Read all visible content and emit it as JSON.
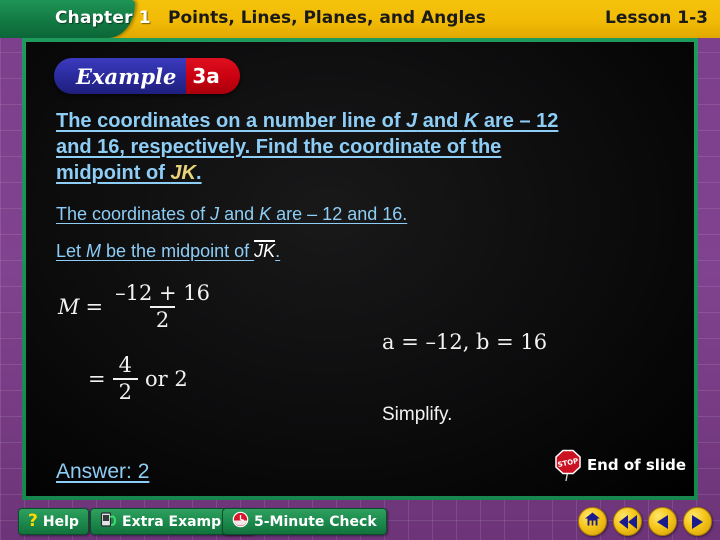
{
  "header": {
    "chapter_label": "Chapter 1",
    "title": "Points, Lines, Planes, and Angles",
    "lesson_label": "Lesson 1-3"
  },
  "example_badge": {
    "word": "Example",
    "number": "3a"
  },
  "question": {
    "line1_a": "The coordinates on a number line of ",
    "line1_j": "J",
    "line1_b": " and ",
    "line1_k": "K",
    "line1_c": " are – 12",
    "line2": "and 16, respectively. Find the coordinate of the",
    "line3_a": "midpoint of ",
    "line3_seg": "JK",
    "line3_b": "."
  },
  "statements": {
    "s1_a": "The coordinates of ",
    "s1_j": "J",
    "s1_b": " and ",
    "s1_k": "K",
    "s1_c": " are – 12 and 16.",
    "s2_a": "Let ",
    "s2_m": "M",
    "s2_b": " be the midpoint of ",
    "s2_seg": "JK",
    "s2_c": "."
  },
  "math": {
    "line1_var": "M",
    "line1_eq": "=",
    "line1_numerator": "–12 + 16",
    "line1_denominator": "2",
    "line2_eq": "=",
    "line2_numerator": "4",
    "line2_denominator": "2",
    "line2_tail": "or 2",
    "side_note_1": "a = –12, b = 16",
    "side_note_2": "Simplify."
  },
  "answer": {
    "label": "Answer: 2"
  },
  "end_of_slide": {
    "label": "End of slide",
    "sign_text": "STOP"
  },
  "toolbar": {
    "help_label": "Help",
    "help_icon": "question-mark-icon",
    "extra_examples_label": "Extra Examples",
    "extra_examples_icon": "book-icon",
    "five_minute_check_label": "5-Minute Check",
    "five_minute_check_icon": "clock-icon",
    "nav": [
      {
        "name": "home",
        "icon": "home-icon"
      },
      {
        "name": "rewind",
        "icon": "double-left-arrow-icon"
      },
      {
        "name": "previous",
        "icon": "left-arrow-icon"
      },
      {
        "name": "next",
        "icon": "right-arrow-icon"
      }
    ]
  },
  "colors": {
    "header_gold": "#f2bb06",
    "chapter_green": "#127a43",
    "frame_green": "#1d9a5c",
    "border_purple": "#7c3f8c",
    "text_blue": "#8ecdf5",
    "segment_yellow": "#e8d27a",
    "example_blue": "#2b2b9e",
    "example_red": "#c8000f",
    "button_green": "#1d8c4e",
    "nav_yellow": "#f5c51a",
    "stop_red": "#cc1122",
    "stage_black": "#0b0b0c"
  }
}
